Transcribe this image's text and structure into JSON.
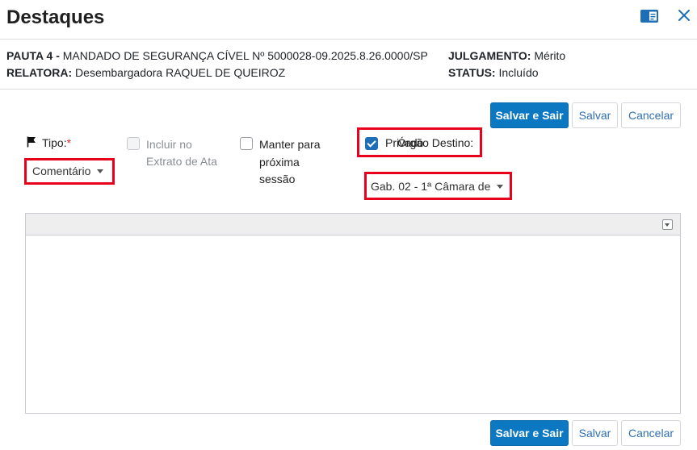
{
  "dialog": {
    "title": "Destaques"
  },
  "info": {
    "pauta_label": "PAUTA 4 -",
    "pauta_value": "MANDADO DE SEGURANÇA CÍVEL Nº 5000028-09.2025.8.26.0000/SP",
    "relatora_label": "RELATORA:",
    "relatora_value": "Desembargadora RAQUEL DE QUEIROZ",
    "julgamento_label": "JULGAMENTO:",
    "julgamento_value": "Mérito",
    "status_label": "STATUS:",
    "status_value": "Incluído"
  },
  "actions": {
    "save_exit": "Salvar e Sair",
    "save": "Salvar",
    "cancel": "Cancelar"
  },
  "form": {
    "tipo_label": "Tipo:",
    "tipo_required": "*",
    "tipo_value": "Comentário",
    "incluir_label_1": "Incluir no",
    "incluir_label_2": "Extrato de Ata",
    "incluir_checked": false,
    "manter_label_1": "Manter para",
    "manter_label_2": "próxima",
    "manter_label_3": "sessão",
    "manter_checked": false,
    "privado_label": "Privado",
    "privado_checked": true,
    "orgao_label": "Órgão Destino:",
    "orgao_value": "Gab. 02 - 1ª Câmara de"
  },
  "icons": {
    "book": "book-open-icon",
    "close": "close-icon",
    "flag": "flag-icon"
  },
  "colors": {
    "primary": "#0d78c2",
    "highlight": "#e8001c"
  }
}
